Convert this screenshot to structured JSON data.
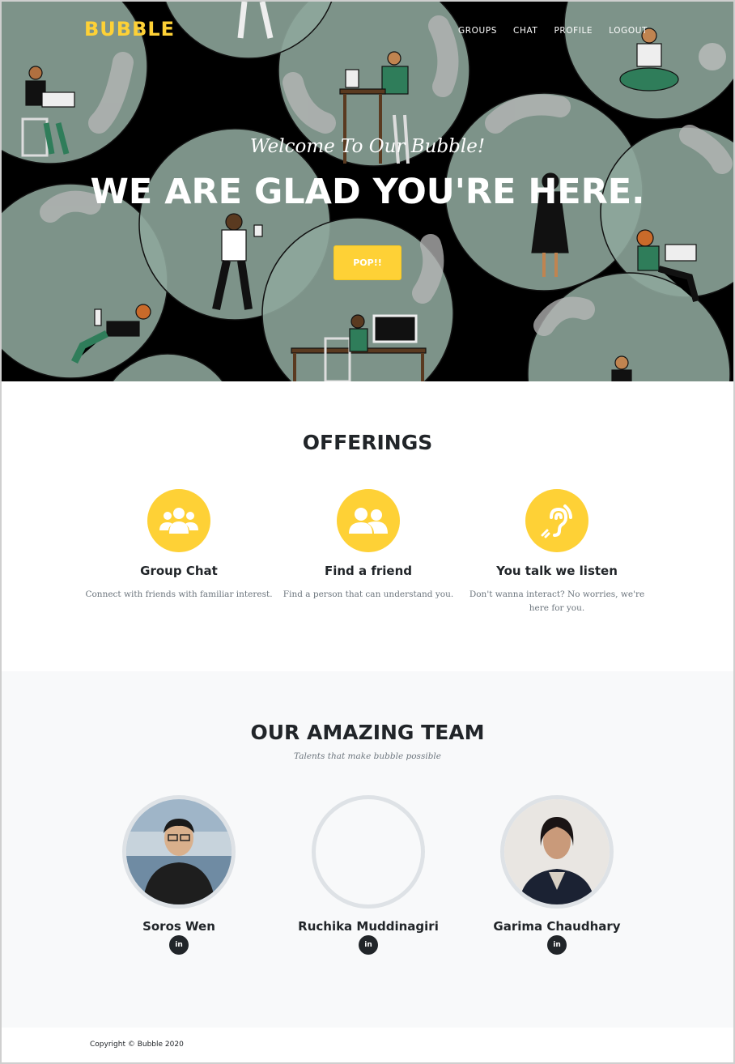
{
  "header": {
    "brand": "BUBBLE",
    "nav": [
      "GROUPS",
      "CHAT",
      "PROFILE",
      "LOGOUT"
    ]
  },
  "hero": {
    "subheading": "Welcome To Our Bubble!",
    "heading": "WE ARE GLAD YOU'RE HERE.",
    "button_label": "POP!!"
  },
  "offerings": {
    "title": "OFFERINGS",
    "items": [
      {
        "title": "Group Chat",
        "text": "Connect with friends with familiar interest.",
        "icon": "group-icon"
      },
      {
        "title": "Find a friend",
        "text": "Find a person that can understand you.",
        "icon": "friends-icon"
      },
      {
        "title": "You talk we listen",
        "text": "Don't wanna interact? No worries, we're here for you.",
        "icon": "listening-icon"
      }
    ]
  },
  "team": {
    "title": "OUR AMAZING TEAM",
    "subtitle": "Talents that make bubble possible",
    "members": [
      {
        "name": "Soros Wen",
        "social": "in"
      },
      {
        "name": "Ruchika Muddinagiri",
        "social": "in"
      },
      {
        "name": "Garima Chaudhary",
        "social": "in"
      }
    ]
  },
  "footer": {
    "copyright": "Copyright © Bubble 2020"
  },
  "colors": {
    "accent": "#fed136",
    "dark": "#212529",
    "muted": "#6c757d",
    "bubble": "#8ea79c"
  }
}
